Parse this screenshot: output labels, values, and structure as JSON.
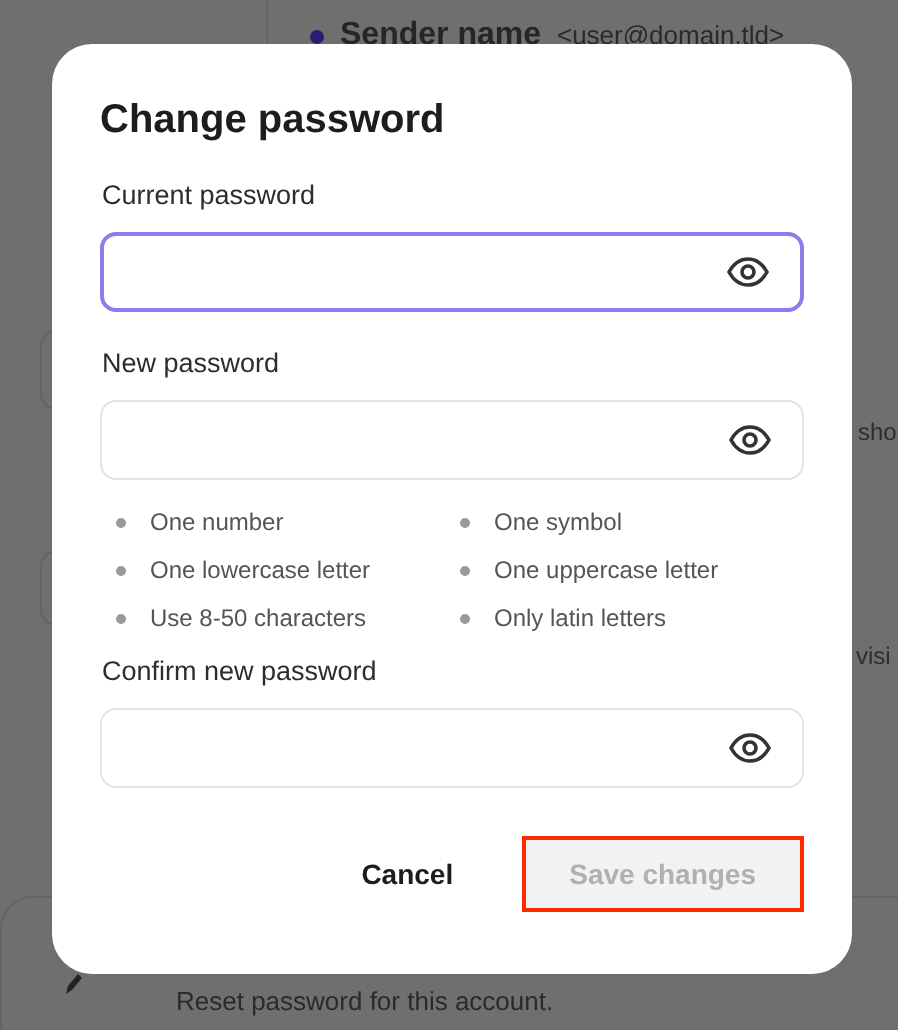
{
  "background": {
    "sender": {
      "name": "Sender name",
      "address": "<user@domain.tld>"
    },
    "fragments": [
      "sho",
      "visi"
    ],
    "reset_text": "Reset password for this account."
  },
  "dialog": {
    "title": "Change password",
    "fields": [
      {
        "label": "Current password",
        "focused": true
      },
      {
        "label": "New password",
        "focused": false,
        "requirements": [
          "One number",
          "One symbol",
          "One lowercase letter",
          "One uppercase letter",
          "Use 8-50 characters",
          "Only latin letters"
        ]
      },
      {
        "label": "Confirm new password",
        "focused": false
      }
    ],
    "buttons": [
      {
        "label": "Cancel",
        "kind": "text",
        "disabled": false,
        "highlighted": false
      },
      {
        "label": "Save changes",
        "kind": "filled",
        "disabled": true,
        "highlighted": true
      }
    ]
  }
}
